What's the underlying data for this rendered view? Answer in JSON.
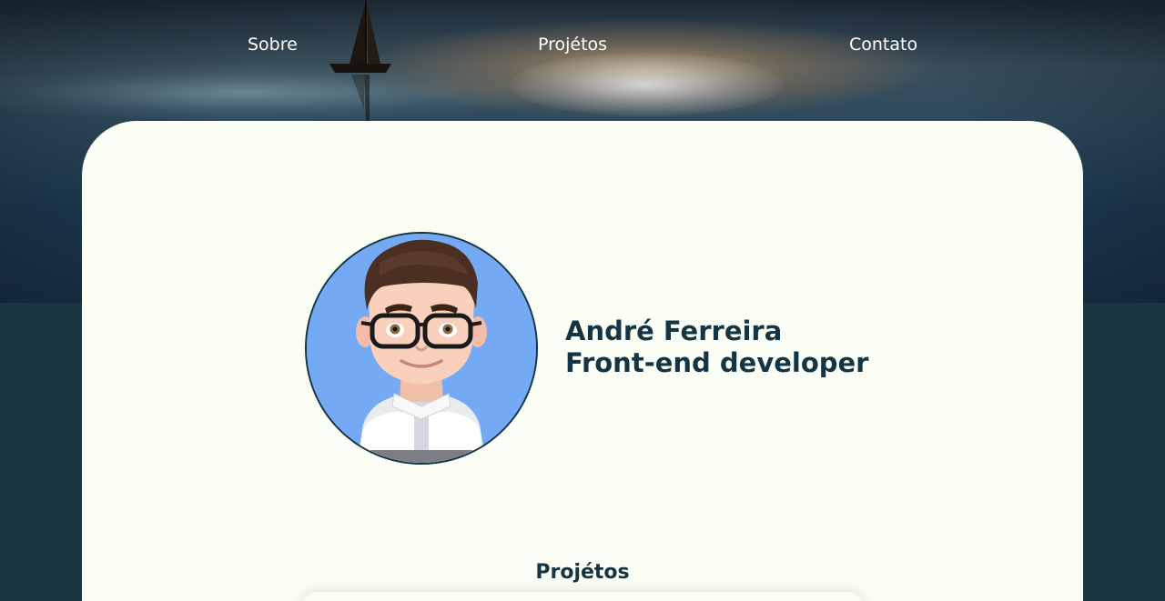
{
  "nav": {
    "items": [
      {
        "label": "Sobre"
      },
      {
        "label": "Projétos"
      },
      {
        "label": "Contato"
      }
    ]
  },
  "profile": {
    "name": "André Ferreira",
    "role": "Front-end developer"
  },
  "sections": {
    "projects_title": "Projétos"
  },
  "colors": {
    "card_background": "#fbfef4",
    "text_primary": "#163544",
    "page_background": "#1a3540",
    "avatar_background": "#74a9f4"
  }
}
